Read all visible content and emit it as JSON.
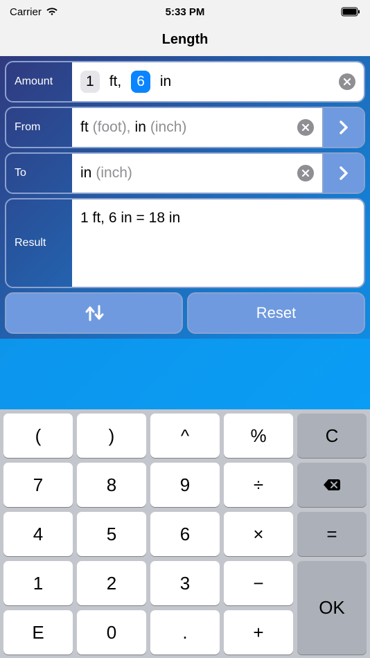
{
  "status": {
    "carrier": "Carrier",
    "time": "5:33 PM"
  },
  "nav": {
    "title": "Length"
  },
  "amount": {
    "label": "Amount",
    "token1_val": "1",
    "token1_unit": "ft,",
    "token2_val": "6",
    "token2_unit": "in"
  },
  "from": {
    "label": "From",
    "unit1": "ft",
    "unit1full": "(foot),",
    "unit2": "in",
    "unit2full": "(inch)"
  },
  "to": {
    "label": "To",
    "unit1": "in",
    "unit1full": "(inch)"
  },
  "result": {
    "label": "Result",
    "text": "1 ft, 6 in = 18 in"
  },
  "buttons": {
    "swap_title": "↑↓",
    "reset": "Reset"
  },
  "keypad": {
    "k_lpar": "(",
    "k_rpar": ")",
    "k_pow": "^",
    "k_pct": "%",
    "k_c": "C",
    "k_7": "7",
    "k_8": "8",
    "k_9": "9",
    "k_div": "÷",
    "k_4": "4",
    "k_5": "5",
    "k_6": "6",
    "k_mul": "×",
    "k_eq": "=",
    "k_1": "1",
    "k_2": "2",
    "k_3": "3",
    "k_sub": "−",
    "k_E": "E",
    "k_0": "0",
    "k_dot": ".",
    "k_add": "+",
    "k_ok": "OK"
  }
}
